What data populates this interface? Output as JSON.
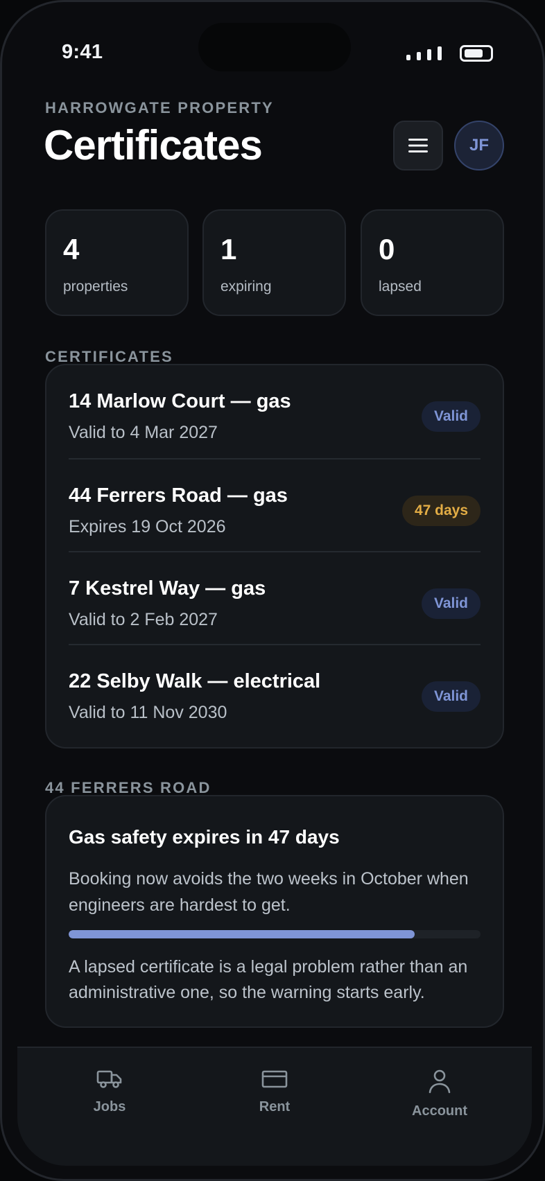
{
  "status_bar": {
    "time": "9:41"
  },
  "header": {
    "eyebrow": "HARROWGATE PROPERTY",
    "title": "Certificates",
    "avatar_initials": "JF"
  },
  "stats": [
    {
      "value": "4",
      "label": "properties"
    },
    {
      "value": "1",
      "label": "expiring"
    },
    {
      "value": "0",
      "label": "lapsed"
    }
  ],
  "certificates_section": {
    "label": "CERTIFICATES",
    "items": [
      {
        "name": "14 Marlow Court — gas",
        "detail": "Valid to 4 Mar 2027",
        "badge": "Valid",
        "status": "valid"
      },
      {
        "name": "44 Ferrers Road — gas",
        "detail": "Expires 19 Oct 2026",
        "badge": "47 days",
        "status": "warn"
      },
      {
        "name": "7 Kestrel Way — gas",
        "detail": "Valid to 2 Feb 2027",
        "badge": "Valid",
        "status": "valid"
      },
      {
        "name": "22 Selby Walk — electrical",
        "detail": "Valid to 11 Nov 2030",
        "badge": "Valid",
        "status": "valid"
      }
    ]
  },
  "alert_section": {
    "label": "44 FERRERS ROAD",
    "title": "Gas safety expires in 47 days",
    "body": "Booking now avoids the two weeks in October when engineers are hardest to get.",
    "progress": 0.84,
    "note": "A lapsed certificate is a legal problem rather than an administrative one, so the warning starts early."
  },
  "tab_bar": {
    "tabs": [
      {
        "label": "Jobs",
        "icon": "truck-icon"
      },
      {
        "label": "Rent",
        "icon": "card-icon"
      },
      {
        "label": "Account",
        "icon": "person-icon"
      }
    ]
  },
  "colors": {
    "accent": "#7f95d6",
    "warning": "#e3ad45",
    "background": "#0b0c0f",
    "card": "#14171b"
  }
}
